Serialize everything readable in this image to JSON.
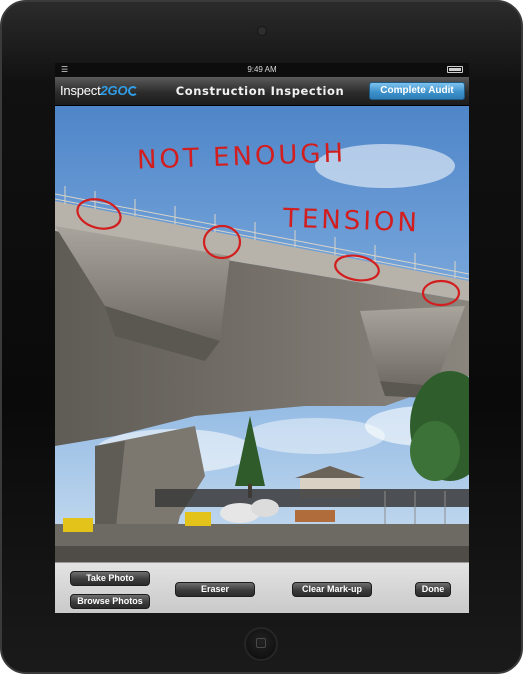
{
  "status_bar": {
    "time": "9:49 AM",
    "wifi_icon": "wifi-icon",
    "battery_icon": "battery-icon"
  },
  "header": {
    "brand_prefix": "Inspect",
    "brand_accent": "2GO",
    "title": "Construction Inspection",
    "complete_button": "Complete Audit"
  },
  "annotations": {
    "line1": "NOT ENOUGH",
    "line2": "TENSION"
  },
  "toolbar": {
    "take_photo": "Take Photo",
    "browse_photos": "Browse Photos",
    "eraser": "Eraser",
    "clear_markup": "Clear Mark-up",
    "done": "Done"
  },
  "colors": {
    "accent": "#2f9ee6",
    "annotation": "#d21e1e",
    "button_blue": "#3d92cc"
  }
}
